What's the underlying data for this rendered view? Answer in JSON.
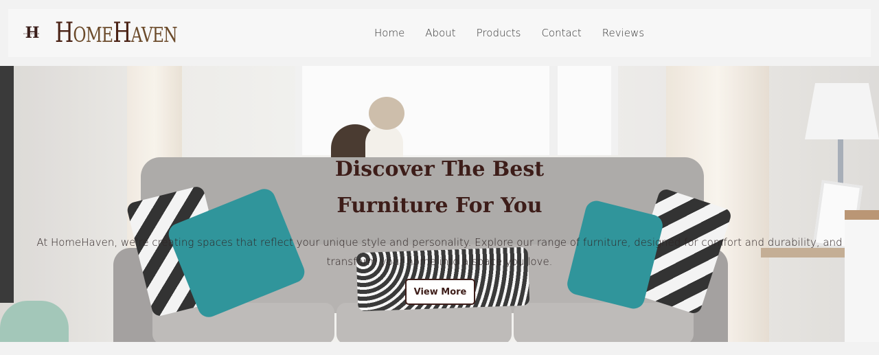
{
  "brand": {
    "logo_mark": "H",
    "logo_mark_tiny": "HOMEHAVEN",
    "name_first_cap": "H",
    "name_first_rest": "OME",
    "name_second_cap": "H",
    "name_second_rest": "AVEN"
  },
  "nav": {
    "items": [
      {
        "label": "Home"
      },
      {
        "label": "About"
      },
      {
        "label": "Products"
      },
      {
        "label": "Contact"
      },
      {
        "label": "Reviews"
      }
    ]
  },
  "hero": {
    "title_line1": "Discover The Best",
    "title_line2": "Furniture For You",
    "description": "At HomeHaven, we're creating spaces that reflect your unique style and personality. Explore our range of furniture, designed for comfort and durability, and transform your home into a space you love.",
    "cta_label": "View More",
    "image_alt_icon": "living-room-photo"
  },
  "colors": {
    "brand_dark": "#3d1d19",
    "header_bg": "#f7f7f7",
    "page_bg": "#f2f2f2"
  }
}
